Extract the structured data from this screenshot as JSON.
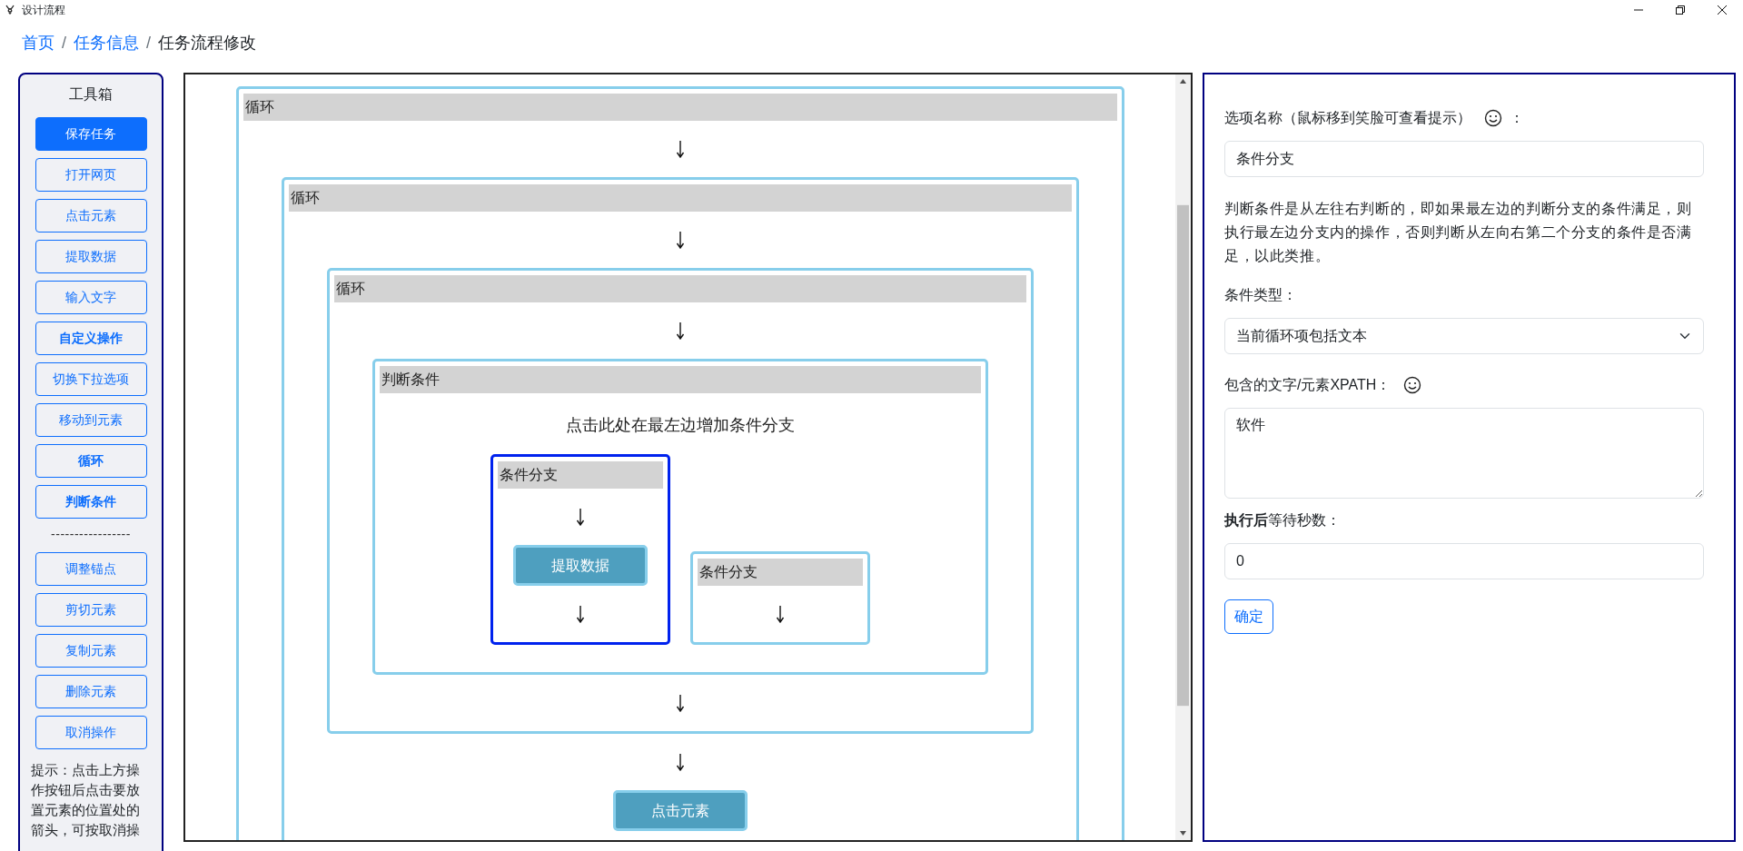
{
  "window": {
    "title": "设计流程"
  },
  "breadcrumb": [
    {
      "kind": "link",
      "label": "首页"
    },
    {
      "kind": "separator",
      "label": "/"
    },
    {
      "kind": "link",
      "label": "任务信息"
    },
    {
      "kind": "separator",
      "label": "/"
    },
    {
      "kind": "current",
      "label": "任务流程修改"
    }
  ],
  "toolbox": {
    "title": "工具箱",
    "items": [
      {
        "kind": "primary",
        "label": "保存任务",
        "bold": false
      },
      {
        "kind": "outline",
        "label": "打开网页",
        "bold": false
      },
      {
        "kind": "outline",
        "label": "点击元素",
        "bold": false
      },
      {
        "kind": "outline",
        "label": "提取数据",
        "bold": false
      },
      {
        "kind": "outline",
        "label": "输入文字",
        "bold": false
      },
      {
        "kind": "outline",
        "label": "自定义操作",
        "bold": true
      },
      {
        "kind": "outline",
        "label": "切换下拉选项",
        "bold": false
      },
      {
        "kind": "outline",
        "label": "移动到元素",
        "bold": false
      },
      {
        "kind": "outline",
        "label": "循环",
        "bold": true
      },
      {
        "kind": "outline",
        "label": "判断条件",
        "bold": true
      },
      {
        "kind": "separator",
        "label": "-----------------",
        "bold": false
      },
      {
        "kind": "outline",
        "label": "调整锚点",
        "bold": false
      },
      {
        "kind": "outline",
        "label": "剪切元素",
        "bold": false
      },
      {
        "kind": "outline",
        "label": "复制元素",
        "bold": false
      },
      {
        "kind": "outline",
        "label": "删除元素",
        "bold": false
      },
      {
        "kind": "outline",
        "label": "取消操作",
        "bold": false
      }
    ],
    "hint": "提示：点击上方操作按钮后点击要放置元素的位置处的箭头，可按取消操"
  },
  "flow": {
    "kind": "loop",
    "title": "循环",
    "selected": false,
    "children": [
      {
        "kind": "loop",
        "title": "循环",
        "selected": false,
        "children": [
          {
            "kind": "loop",
            "title": "循环",
            "selected": false,
            "children": [
              {
                "kind": "condition",
                "title": "判断条件",
                "add_hint": "点击此处在最左边增加条件分支",
                "selected": false,
                "children": [
                  {
                    "kind": "branch",
                    "title": "条件分支",
                    "selected": true,
                    "children": [
                      {
                        "kind": "action",
                        "label": "提取数据",
                        "selected": false
                      }
                    ]
                  },
                  {
                    "kind": "branch",
                    "title": "条件分支",
                    "selected": false
                  }
                ]
              }
            ]
          },
          {
            "kind": "action",
            "label": "点击元素",
            "selected": false
          }
        ]
      }
    ]
  },
  "options": {
    "fields": [
      {
        "kind": "label",
        "text": "选项名称（鼠标移到笑脸可查看提示）",
        "help_icon": true,
        "suffix": "："
      },
      {
        "kind": "input",
        "value": "条件分支"
      },
      {
        "kind": "paragraph",
        "text": "判断条件是从左往右判断的，即如果最左边的判断分支的条件满足，则执行最左边分支内的操作，否则判断从左向右第二个分支的条件是否满足，以此类推。"
      },
      {
        "kind": "label",
        "text": "条件类型：",
        "help_icon": false
      },
      {
        "kind": "select",
        "value": "当前循环项包括文本"
      },
      {
        "kind": "label",
        "text": "包含的文字/元素XPATH：",
        "help_icon": true
      },
      {
        "kind": "textarea",
        "value": "软件"
      },
      {
        "kind": "label",
        "text": "**执行后**等待秒数：",
        "help_icon": false
      },
      {
        "kind": "input",
        "value": "0"
      },
      {
        "kind": "button",
        "label": "确定"
      }
    ]
  }
}
